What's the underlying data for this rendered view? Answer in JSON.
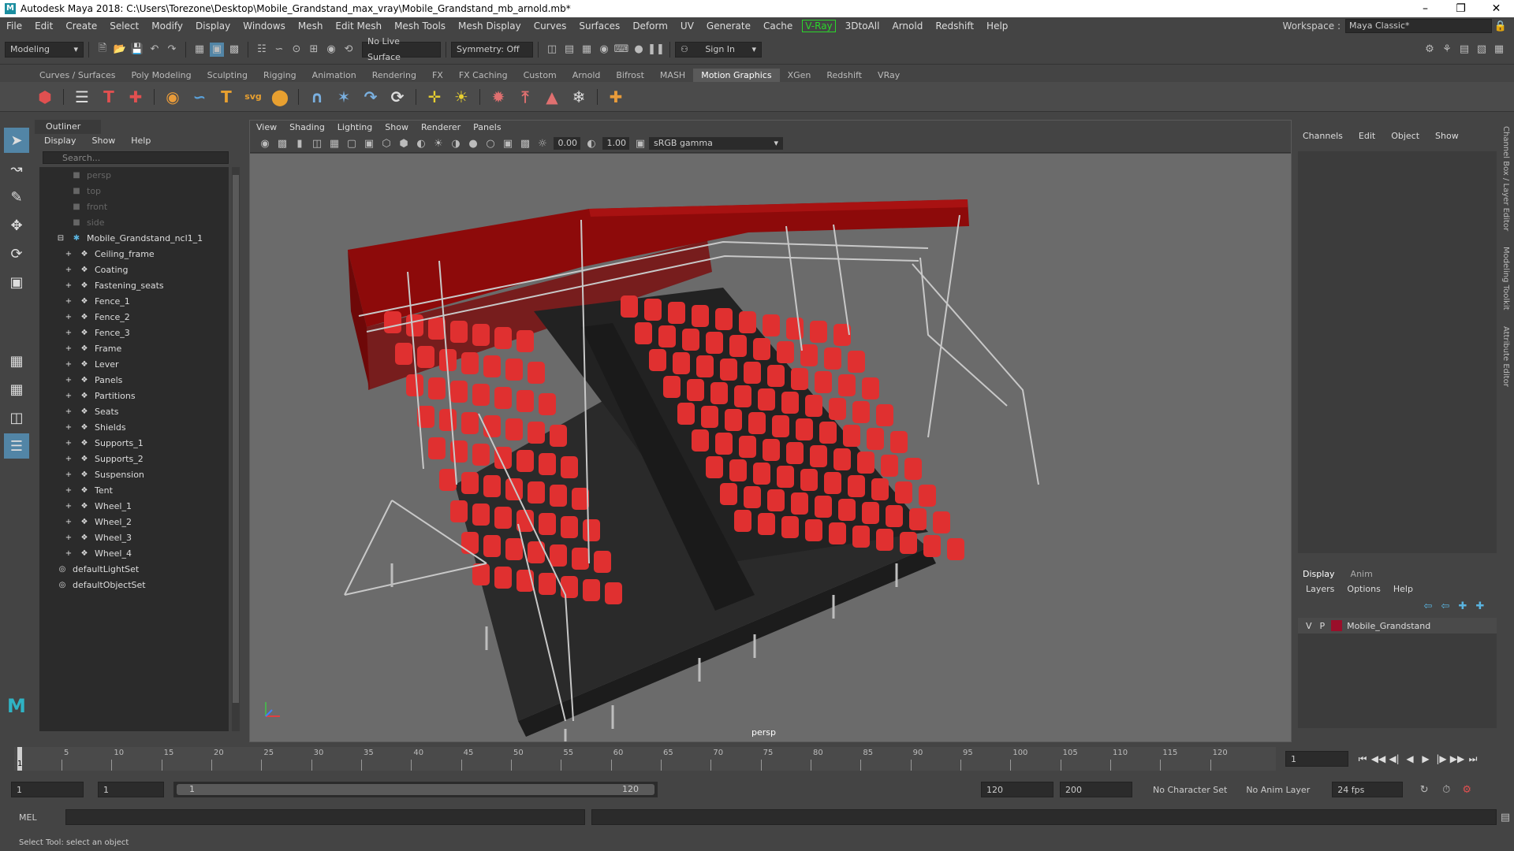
{
  "window": {
    "title": "Autodesk Maya 2018: C:\\Users\\Torezone\\Desktop\\Mobile_Grandstand_max_vray\\Mobile_Grandstand_mb_arnold.mb*",
    "logo": "M"
  },
  "menubar": {
    "items": [
      "File",
      "Edit",
      "Create",
      "Select",
      "Modify",
      "Display",
      "Windows",
      "Mesh",
      "Edit Mesh",
      "Mesh Tools",
      "Mesh Display",
      "Curves",
      "Surfaces",
      "Deform",
      "UV",
      "Generate",
      "Cache"
    ],
    "vray": "V-Ray",
    "items2": [
      "3DtoAll",
      "Arnold",
      "Redshift",
      "Help"
    ],
    "workspace_label": "Workspace :",
    "workspace_value": "Maya Classic*"
  },
  "statusline": {
    "mode": "Modeling",
    "live_surface": "No Live Surface",
    "symmetry": "Symmetry: Off",
    "sign_in": "Sign In"
  },
  "shelf": {
    "tabs": [
      "Curves / Surfaces",
      "Poly Modeling",
      "Sculpting",
      "Rigging",
      "Animation",
      "Rendering",
      "FX",
      "FX Caching",
      "Custom",
      "Arnold",
      "Bifrost",
      "MASH",
      "Motion Graphics",
      "XGen",
      "Redshift",
      "VRay"
    ],
    "active_tab": "Motion Graphics"
  },
  "outliner": {
    "title": "Outliner",
    "menu": [
      "Display",
      "Show",
      "Help"
    ],
    "search_placeholder": "Search...",
    "cameras": [
      "persp",
      "top",
      "front",
      "side"
    ],
    "group": "Mobile_Grandstand_ncl1_1",
    "children": [
      "Ceiling_frame",
      "Coating",
      "Fastening_seats",
      "Fence_1",
      "Fence_2",
      "Fence_3",
      "Frame",
      "Lever",
      "Panels",
      "Partitions",
      "Seats",
      "Shields",
      "Supports_1",
      "Supports_2",
      "Suspension",
      "Tent",
      "Wheel_1",
      "Wheel_2",
      "Wheel_3",
      "Wheel_4"
    ],
    "sets": [
      "defaultLightSet",
      "defaultObjectSet"
    ]
  },
  "viewport": {
    "menu": [
      "View",
      "Shading",
      "Lighting",
      "Show",
      "Renderer",
      "Panels"
    ],
    "exposure": "0.00",
    "gamma": "1.00",
    "color_space": "sRGB gamma",
    "camera": "persp"
  },
  "channelbox": {
    "menu": [
      "Channels",
      "Edit",
      "Object",
      "Show"
    ],
    "side_tabs": [
      "Channel Box / Layer Editor",
      "Modeling Toolkit",
      "Attribute Editor"
    ]
  },
  "layers": {
    "tabs": [
      "Display",
      "Anim"
    ],
    "active_tab": "Display",
    "menu": [
      "Layers",
      "Options",
      "Help"
    ],
    "visible": "V",
    "playback": "P",
    "layer_name": "Mobile_Grandstand",
    "layer_color": "#9a0f2a"
  },
  "timeline": {
    "ticks": [
      "5",
      "10",
      "15",
      "20",
      "25",
      "30",
      "35",
      "40",
      "45",
      "50",
      "55",
      "60",
      "65",
      "70",
      "75",
      "80",
      "85",
      "90",
      "95",
      "100",
      "105",
      "110",
      "115",
      "120"
    ],
    "current_frame": "1",
    "current_field": "1"
  },
  "range": {
    "start": "1",
    "playback_start": "1",
    "slider_start": "1",
    "slider_end": "120",
    "playback_end": "120",
    "end": "200",
    "character_set": "No Character Set",
    "anim_layer": "No Anim Layer",
    "fps": "24 fps"
  },
  "command": {
    "label": "MEL"
  },
  "help_line": "Select Tool: select an object"
}
